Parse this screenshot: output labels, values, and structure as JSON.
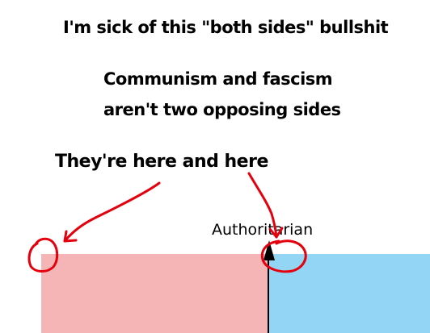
{
  "headline": {
    "line1": "I'm sick of this \"both sides\" bullshit",
    "line2": "Communism and fascism",
    "line3": "aren't two opposing sides",
    "line4": "They're here and here"
  },
  "compass": {
    "axis_label": "Authoritarian"
  },
  "colors": {
    "left_quadrant": "#f5b5b6",
    "right_quadrant": "#92d5f4",
    "annotation_red": "#e5000d",
    "axis": "#000000"
  }
}
